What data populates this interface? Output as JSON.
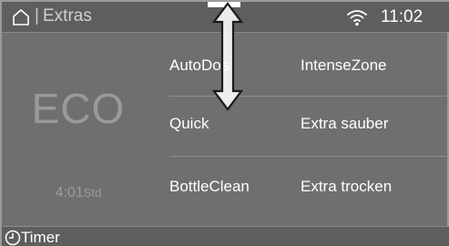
{
  "status_bar": {
    "breadcrumb_separator": "|",
    "title": "Extras",
    "home_icon": "home-icon",
    "wifi_icon": "wifi-icon",
    "time": "11:02"
  },
  "program": {
    "name": "ECO",
    "duration_value": "4:01",
    "duration_unit": "Std"
  },
  "options": [
    {
      "label": "AutoDos"
    },
    {
      "label": "IntenseZone"
    },
    {
      "label": "Quick"
    },
    {
      "label": "Extra sauber"
    },
    {
      "label": "BottleClean"
    },
    {
      "label": "Extra trocken"
    }
  ],
  "bottom_bar": {
    "timer_icon": "clock-icon",
    "timer_label": "Timer"
  },
  "scroll_indicator_icon": "double-arrow-icon"
}
